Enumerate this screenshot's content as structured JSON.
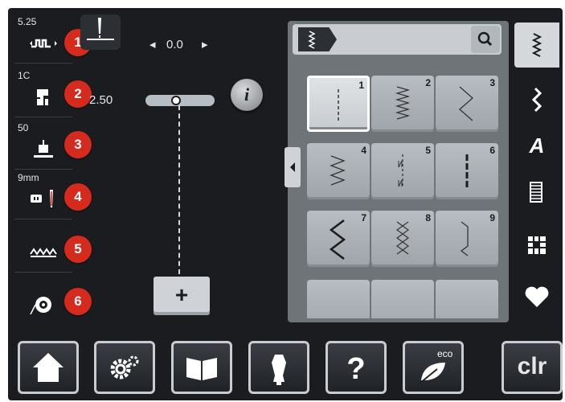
{
  "left_panel": {
    "items": [
      {
        "value": "5.25",
        "icon": "stitch-width-icon",
        "badge": "1"
      },
      {
        "value": "1C",
        "icon": "presser-foot-indicator-icon",
        "badge": "2"
      },
      {
        "value": "50",
        "icon": "presser-foot-pressure-icon",
        "badge": "3"
      },
      {
        "value": "9mm",
        "icon": "needle-plate-icon",
        "badge": "4"
      },
      {
        "value": "",
        "icon": "feed-dog-icon",
        "badge": "5"
      },
      {
        "value": "",
        "icon": "bobbin-thread-icon",
        "badge": "6"
      }
    ]
  },
  "center": {
    "needle_position": "0.0",
    "stitch_length": "2.50",
    "info_label": "i",
    "plus_label": "+"
  },
  "stitch_panel": {
    "header_tab": "stitch-category-tag",
    "stitches": [
      {
        "num": "1",
        "pattern": "straight"
      },
      {
        "num": "2",
        "pattern": "zigzag-dense"
      },
      {
        "num": "3",
        "pattern": "zigzag-wide"
      },
      {
        "num": "4",
        "pattern": "zigzag-3step"
      },
      {
        "num": "5",
        "pattern": "straight-bar"
      },
      {
        "num": "6",
        "pattern": "triple-straight"
      },
      {
        "num": "7",
        "pattern": "zigzag-bold"
      },
      {
        "num": "8",
        "pattern": "honeycomb"
      },
      {
        "num": "9",
        "pattern": "blind-hem"
      }
    ]
  },
  "right_panel": {
    "items": [
      "practical-stitches-icon",
      "decorative-stitches-icon",
      "alphabets-icon",
      "buttonholes-icon",
      "quilt-stitches-icon",
      "personal-program-icon"
    ]
  },
  "bottom_bar": {
    "home": "home-icon",
    "settings": "settings-icon",
    "tutorial": "tutorial-icon",
    "consultant": "sewing-consultant-icon",
    "help": "help-icon",
    "eco_label": "eco",
    "clr_label": "clr"
  },
  "colors": {
    "accent": "#d42b1e",
    "background": "#1a1c1f",
    "tile": "#b7bdc3"
  }
}
